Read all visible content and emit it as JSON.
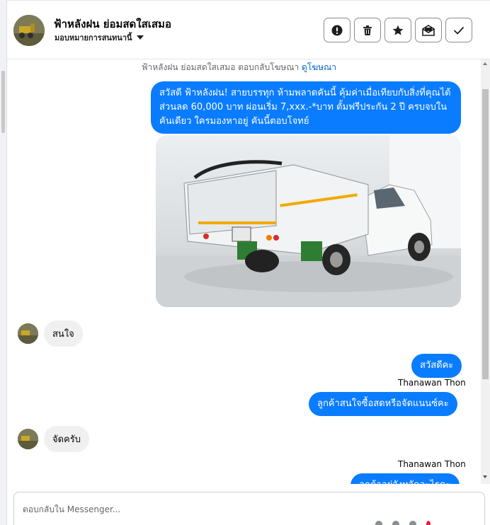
{
  "header": {
    "page_title": "ฟ้าหลังฝน ย่อมสดใสเสมอ",
    "assign_label": "มอบหมายการสนทนานี้",
    "actions": [
      "mark-spam",
      "delete",
      "star",
      "mark-unread",
      "done"
    ]
  },
  "thread": {
    "ad_reply_text": "ฟ้าหลังฝน ย่อมสดใสเสมอ ตอบกลับโฆษณา",
    "ad_link_label": "ดูโฆษณา",
    "messages": [
      {
        "from": "page",
        "text": "สวัสดี ฟ้าหลังฝน! สายบรรทุก ห้ามพลาดคันนี้ คุ้มค่าเมื่อเทียบกับสิ่งที่คุณได้ ส่วนลด 60,000 บาท ผ่อนเริ่ม 7,xxx.-*บาท ตั้มฟรีประกัน 2 ปี ครบจบในคันเดียว ใครมองหาอยู่ คันนี้ตอบโจทย์"
      },
      {
        "from": "customer",
        "text": "สนใจ"
      },
      {
        "from": "page",
        "text": "สวัสดีคะ"
      },
      {
        "from": "page",
        "sender": "Thanawan Thon",
        "text": "ลูกค้าสนใจซื้อสดหรือจัดแนนซ์คะ"
      },
      {
        "from": "customer",
        "text": "จัดครับ"
      },
      {
        "from": "page",
        "sender": "Thanawan Thon",
        "text": "ลูกค้าอยู่จังหวัดอะไรคะ"
      }
    ]
  },
  "composer": {
    "placeholder": "ตอบกลับใน Messenger..."
  },
  "colors": {
    "outgoing_bubble": "#0a7cff",
    "incoming_bubble": "#f0f0f0",
    "link": "#0064d1"
  }
}
